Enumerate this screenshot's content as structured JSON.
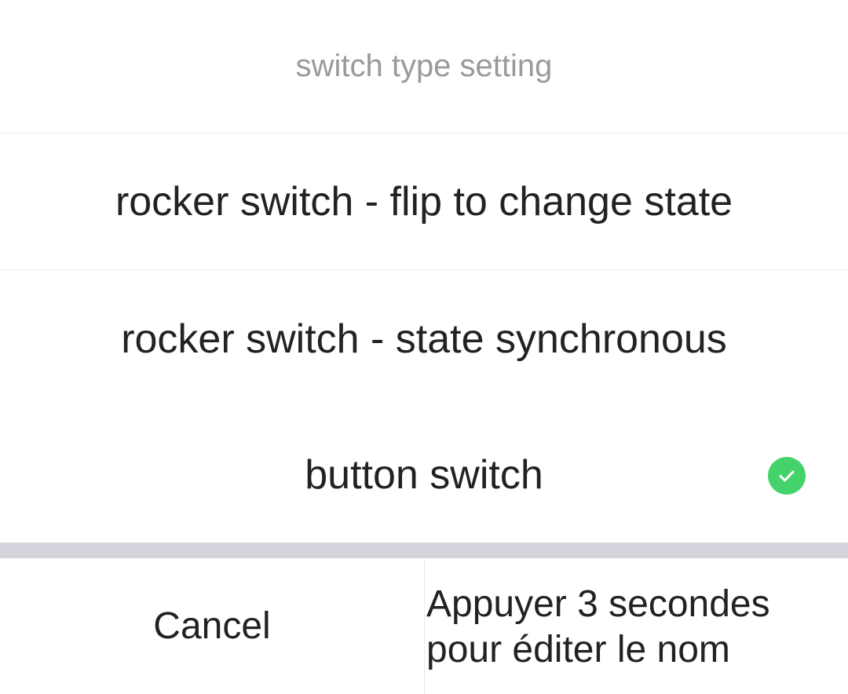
{
  "sheet": {
    "title": "switch type setting",
    "options": [
      {
        "label": "rocker switch - flip to change state",
        "selected": false
      },
      {
        "label": "rocker switch - state synchronous",
        "selected": false
      },
      {
        "label": "button switch",
        "selected": true
      }
    ]
  },
  "footer": {
    "cancel_label": "Cancel",
    "overlay_text": "Appuyer 3 secondes\npour éditer le nom"
  },
  "colors": {
    "accent": "#44d36a",
    "separator": "#d4d4dd"
  },
  "icons": {
    "selected": "check-circle-icon"
  }
}
